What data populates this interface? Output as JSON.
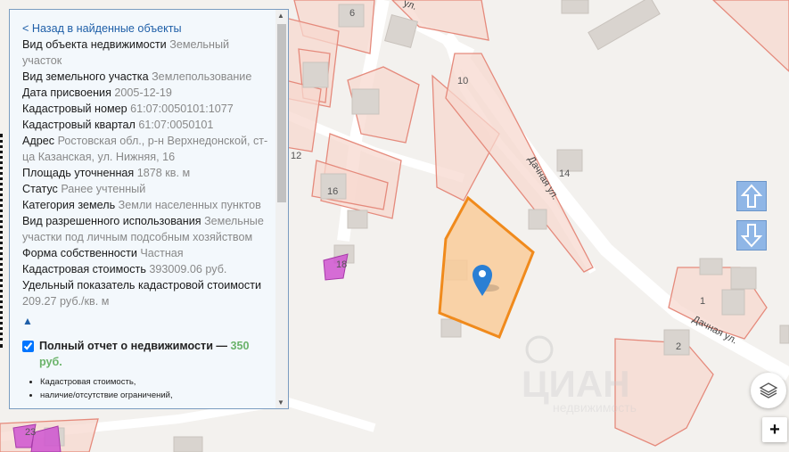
{
  "panel": {
    "back_link": "< Назад в найденные объекты",
    "fields": [
      {
        "key": "Вид объекта недвижимости",
        "value": "Земельный участок"
      },
      {
        "key": "Вид земельного участка",
        "value": "Землепользование"
      },
      {
        "key": "Дата присвоения",
        "value": "2005-12-19"
      },
      {
        "key": "Кадастровый номер",
        "value": "61:07:0050101:1077"
      },
      {
        "key": "Кадастровый квартал",
        "value": "61:07:0050101"
      },
      {
        "key": "Адрес",
        "value": "Ростовская обл., р-н Верхнедонской, ст-ца Казанская, ул. Нижняя, 16"
      },
      {
        "key": "Площадь уточненная",
        "value": "1878 кв. м"
      },
      {
        "key": "Статус",
        "value": "Ранее учтенный"
      },
      {
        "key": "Категория земель",
        "value": "Земли населенных пунктов"
      },
      {
        "key": "Вид разрешенного использования",
        "value": "Земельные участки под личным подсобным хозяйством"
      },
      {
        "key": "Форма собственности",
        "value": "Частная"
      },
      {
        "key": "Кадастровая стоимость",
        "value": "393009.06 руб."
      },
      {
        "key": "Удельный показатель кадастровой стоимости",
        "value": "209.27 руб./кв. м"
      }
    ],
    "collapse_icon": "▲",
    "report": {
      "checked": true,
      "label": "Полный отчет о недвижимости —",
      "price": "350 руб."
    },
    "bullets": [
      "Кадастровая стоимость,",
      "наличие/отсутствие ограничений,"
    ]
  },
  "map": {
    "labels": {
      "n6": "6",
      "n10": "10",
      "n12": "12",
      "n14": "14",
      "n16": "16",
      "n18": "18",
      "n1": "1",
      "n2": "2",
      "n23": "23"
    },
    "streets": {
      "dachnaya1": "Дачная ул.",
      "dachnaya2": "Дачная ул.",
      "ul_top": "ул."
    },
    "watermark": "ЦИАН",
    "watermark_sub": "недвижимость"
  },
  "controls": {
    "arrow_up": "up-arrow-icon",
    "arrow_down": "down-arrow-icon",
    "layers": "layers-icon",
    "zoom_in": "+"
  },
  "colors": {
    "parcel_border": "#e58a7c",
    "parcel_fill": "#f7d8cf",
    "selected_border": "#f08a1c",
    "selected_fill": "#f9cc9a",
    "marker": "#2a7fd4",
    "purple": "#cf55d0",
    "control_blue": "#8fb6e6",
    "link": "#1f5fa8",
    "price": "#6bb36a"
  }
}
